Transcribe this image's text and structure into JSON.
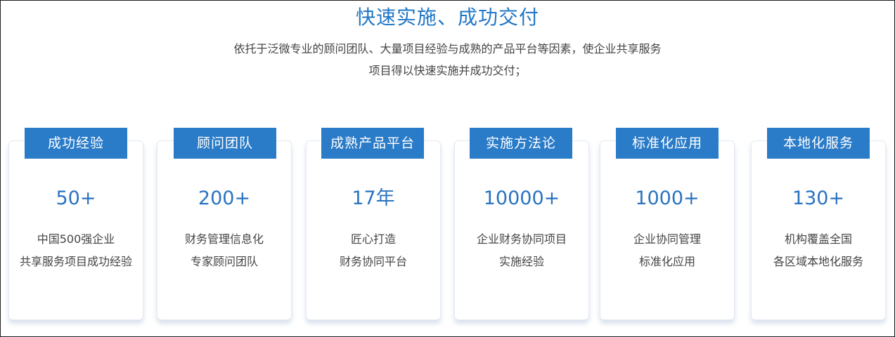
{
  "section": {
    "title": "快速实施、成功交付",
    "subtitle_line1": "依托于泛微专业的顾问团队、大量项目经验与成熟的产品平台等因素，使企业共享服务",
    "subtitle_line2": "项目得以快速实施并成功交付；"
  },
  "cards": [
    {
      "tag": "成功经验",
      "stat": "50+",
      "line1": "中国500强企业",
      "line2": "共享服务项目成功经验"
    },
    {
      "tag": "顾问团队",
      "stat": "200+",
      "line1": "财务管理信息化",
      "line2": "专家顾问团队"
    },
    {
      "tag": "成熟产品平台",
      "stat": "17年",
      "line1": "匠心打造",
      "line2": "财务协同平台"
    },
    {
      "tag": "实施方法论",
      "stat": "10000+",
      "line1": "企业财务协同项目",
      "line2": "实施经验"
    },
    {
      "tag": "标准化应用",
      "stat": "1000+",
      "line1": "企业协同管理",
      "line2": "标准化应用"
    },
    {
      "tag": "本地化服务",
      "stat": "130+",
      "line1": "机构覆盖全国",
      "line2": "各区域本地化服务"
    }
  ],
  "colors": {
    "accent": "#2a7bc8",
    "title": "#2277c6",
    "text": "#444444"
  }
}
